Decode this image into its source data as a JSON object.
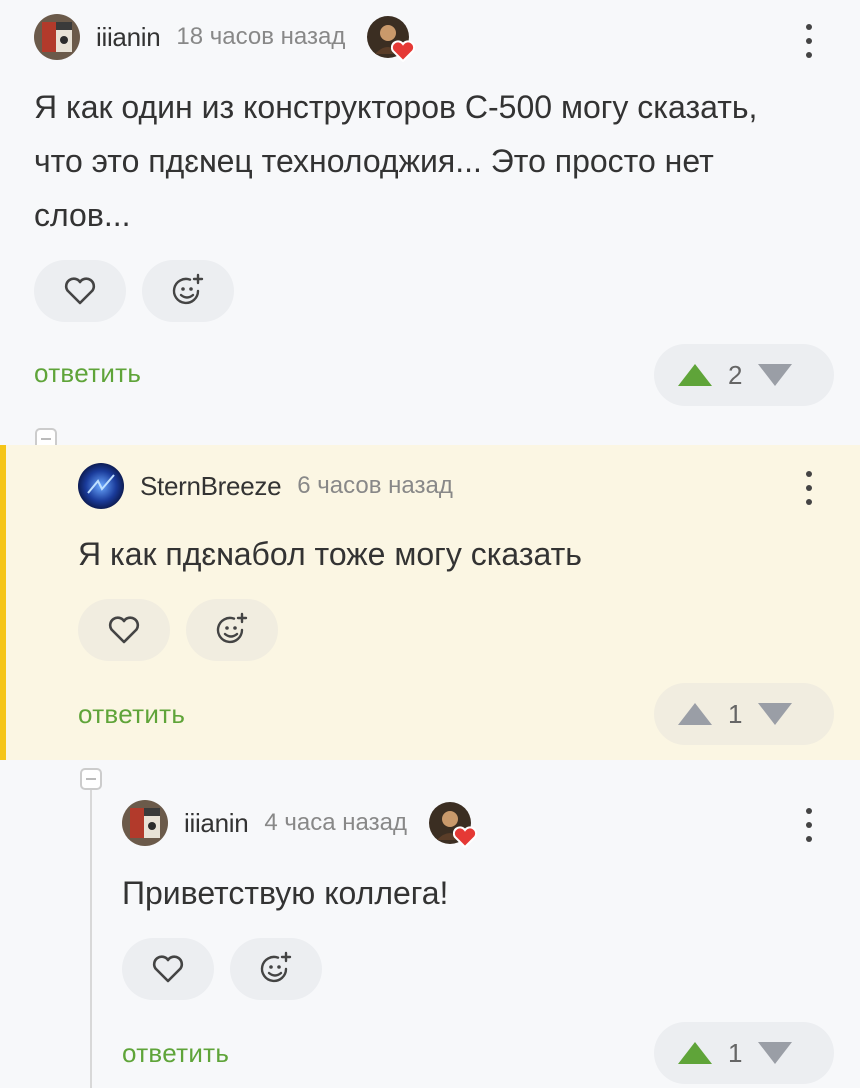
{
  "comments": [
    {
      "author": "iiianin",
      "time": "18 часов назад",
      "text": "Я как один из конструкторов С-500 могу сказать, что это пдɛɴец технолоджия... Это просто нет слов...",
      "reply_label": "ответить",
      "rating": "2"
    },
    {
      "author": "SternBreeze",
      "time": "6 часов назад",
      "text": "Я как пдɛɴабол тоже могу сказать",
      "reply_label": "ответить",
      "rating": "1"
    },
    {
      "author": "iiianin",
      "time": "4 часа назад",
      "text": "Приветствую коллега!",
      "reply_label": "ответить",
      "rating": "1"
    }
  ],
  "colors": {
    "accent_green": "#5fa439",
    "vote_up_green": "#5fa439",
    "vote_neutral": "#9a9ea6",
    "highlight_bg": "#fbf6e3",
    "highlight_bar": "#f5c518",
    "heart_red": "#e53935"
  },
  "icons": [
    "heart-outline-icon",
    "emoji-add-icon",
    "upvote-icon",
    "downvote-icon",
    "more-dots-icon",
    "collapse-icon"
  ]
}
